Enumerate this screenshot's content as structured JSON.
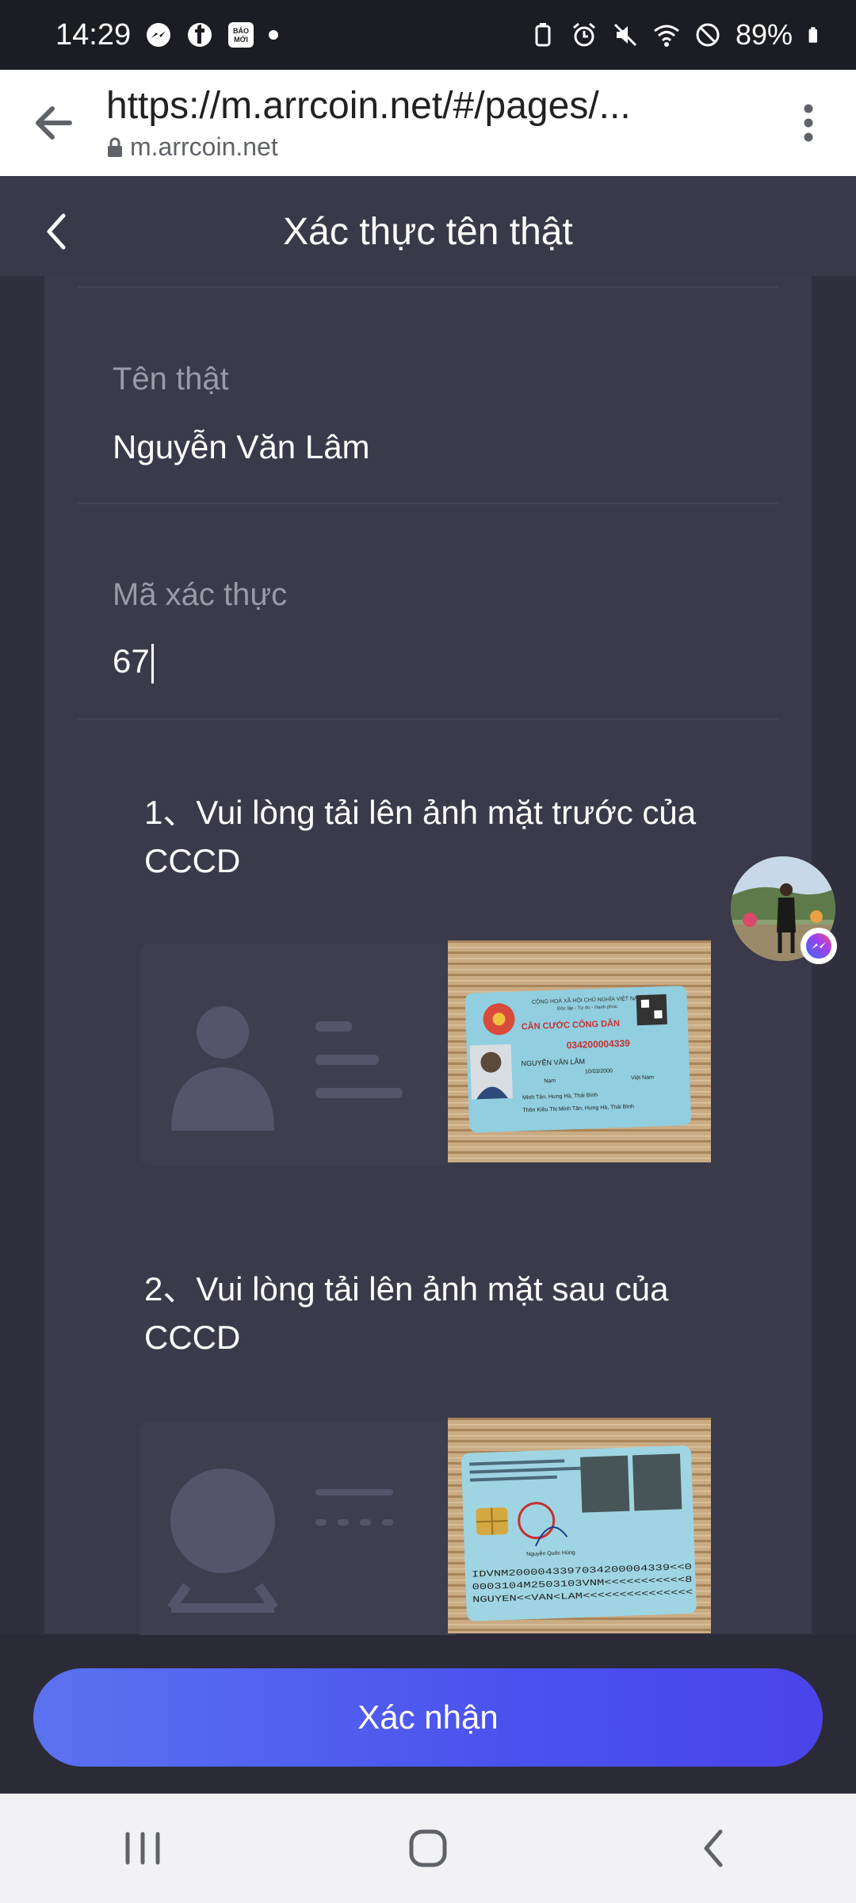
{
  "status_bar": {
    "time": "14:29",
    "battery": "89%",
    "left_icons": [
      "messenger-icon",
      "facebook-icon",
      "baomoi-icon"
    ],
    "baomoi_text": "BÁO MỚI",
    "right_icons": [
      "battery-saver-icon",
      "alarm-icon",
      "mute-icon",
      "wifi-icon",
      "dnd-icon",
      "battery-icon"
    ]
  },
  "browser": {
    "url": "https://m.arrcoin.net/#/pages/...",
    "domain": "m.arrcoin.net"
  },
  "header": {
    "title": "Xác thực tên thật"
  },
  "form": {
    "real_name_label": "Tên thật",
    "real_name_value": "Nguyễn Văn Lâm",
    "code_label": "Mã xác thực",
    "code_value": "67"
  },
  "uploads": {
    "front_title": "1、Vui lòng tải lên ảnh mặt trước của CCCD",
    "back_title": "2、Vui lòng tải lên ảnh mặt sau của CCCD",
    "front_card": {
      "header1": "CỘNG HOÀ XÃ HỘI CHỦ NGHĨA VIỆT NAM",
      "header2": "Độc lập - Tự do - Hạnh phúc",
      "title": "CĂN CƯỚC CÔNG DÂN",
      "number": "034200004339",
      "name": "NGUYỄN VĂN LÂM",
      "dob": "10/03/2000",
      "sex": "Nam",
      "nationality": "Việt Nam",
      "origin": "Minh Tân, Hưng Hà, Thái Bình",
      "residence": "Thôn Kiều Thị Minh Tân, Hưng Hà, Thái Bình"
    },
    "back_card": {
      "signer": "Nguyễn Quốc Hùng",
      "mrz1": "IDVNM2000043397034200004339<<0",
      "mrz2": "0003104M2503103VNM<<<<<<<<<<<8",
      "mrz3": "NGUYEN<<VAN<LAM<<<<<<<<<<<<<<<"
    }
  },
  "confirm_button": "Xác nhận",
  "colors": {
    "page_bg": "#2f2f3d",
    "card_bg": "#3a3a4a",
    "accent": "#4a52ee"
  }
}
